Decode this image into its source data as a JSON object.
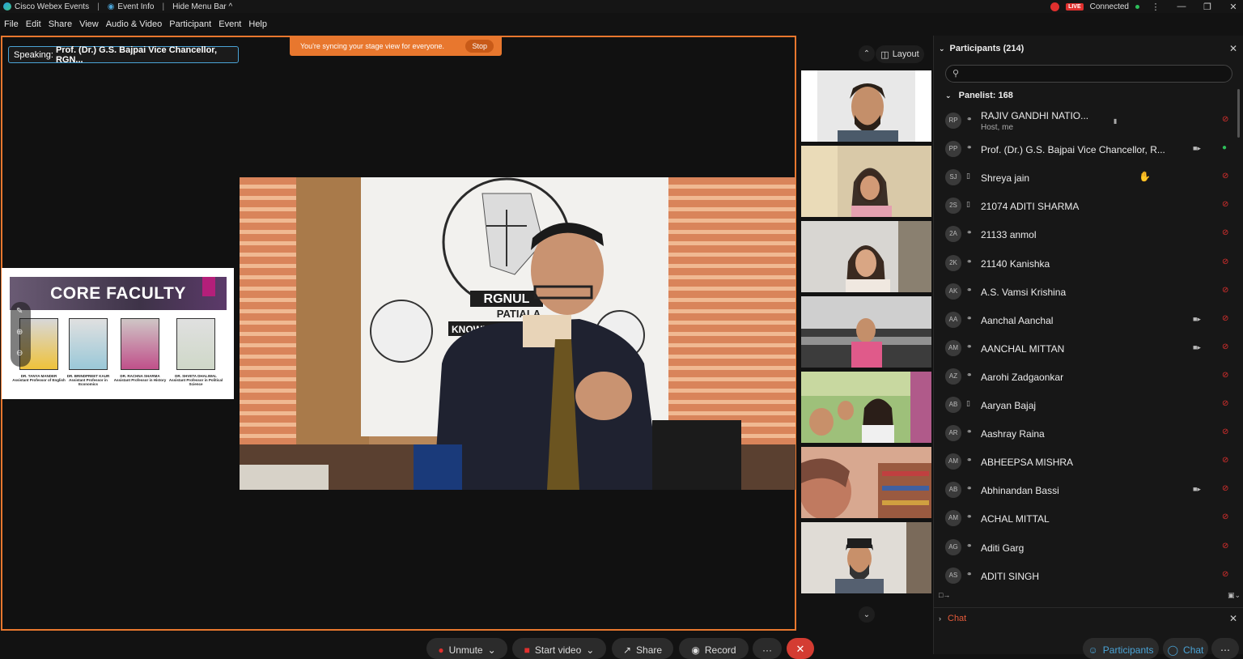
{
  "titlebar": {
    "app_name": "Cisco Webex Events",
    "event_info": "Event Info",
    "hide_menu_bar": "Hide Menu Bar",
    "live_badge": "LIVE",
    "connection_status": "Connected"
  },
  "menu": [
    "File",
    "Edit",
    "Share",
    "View",
    "Audio & Video",
    "Participant",
    "Event",
    "Help"
  ],
  "stage": {
    "speaking_label": "Speaking:",
    "speaking_name": "Prof. (Dr.) G.S. Bajpai Vice Chancellor, RGN...",
    "sync_message": "You're syncing your stage view for everyone.",
    "stop_label": "Stop"
  },
  "slide": {
    "title": "CORE FACULTY",
    "faculty": [
      {
        "name": "DR. TANYA MANDER",
        "role": "Assistant Professor of English"
      },
      {
        "name": "DR. BRINDPREET KAUR",
        "role": "Assistant Professor in Economics"
      },
      {
        "name": "DR. RACHNA SHARMA",
        "role": "Assistant Professor in History"
      },
      {
        "name": "DR. SHVETA DHALIWAL",
        "role": "Assistant Professor in Political Science"
      }
    ]
  },
  "video_backdrop": {
    "banner_text": "RGNUL",
    "city": "PATIALA",
    "tagline": "KNOWLEDGE EMPOWERS"
  },
  "layout_label": "Layout",
  "participants": {
    "header": "Participants (214)",
    "search_placeholder": "",
    "group_label": "Panelist: 168",
    "list": [
      {
        "initials": "RP",
        "name": "RAJIV GANDHI NATIO...",
        "subtitle": "Host, me",
        "device": "headset",
        "video": false,
        "mic": "muted"
      },
      {
        "initials": "PP",
        "name": "Prof. (Dr.) G.S. Bajpai Vice Chancellor, R...",
        "subtitle": "",
        "device": "headset",
        "video": true,
        "mic": "active"
      },
      {
        "initials": "SJ",
        "name": "Shreya jain",
        "subtitle": "",
        "device": "phone",
        "video": false,
        "mic": "muted",
        "hand": true
      },
      {
        "initials": "2S",
        "name": "21074 ADITI SHARMA",
        "subtitle": "",
        "device": "phone",
        "video": false,
        "mic": "muted"
      },
      {
        "initials": "2A",
        "name": "21133 anmol",
        "subtitle": "",
        "device": "headset",
        "video": false,
        "mic": "muted"
      },
      {
        "initials": "2K",
        "name": "21140 Kanishka",
        "subtitle": "",
        "device": "headset",
        "video": false,
        "mic": "muted"
      },
      {
        "initials": "AK",
        "name": "A.S. Vamsi Krishina",
        "subtitle": "",
        "device": "headset",
        "video": false,
        "mic": "muted"
      },
      {
        "initials": "AA",
        "name": "Aanchal Aanchal",
        "subtitle": "",
        "device": "headset",
        "video": true,
        "mic": "muted"
      },
      {
        "initials": "AM",
        "name": "AANCHAL MITTAN",
        "subtitle": "",
        "device": "headset",
        "video": true,
        "mic": "muted"
      },
      {
        "initials": "AZ",
        "name": "Aarohi Zadgaonkar",
        "subtitle": "",
        "device": "headset",
        "video": false,
        "mic": "muted"
      },
      {
        "initials": "AB",
        "name": "Aaryan Bajaj",
        "subtitle": "",
        "device": "phone",
        "video": false,
        "mic": "muted"
      },
      {
        "initials": "AR",
        "name": "Aashray Raina",
        "subtitle": "",
        "device": "headset",
        "video": false,
        "mic": "muted"
      },
      {
        "initials": "AM",
        "name": "ABHEEPSA MISHRA",
        "subtitle": "",
        "device": "headset",
        "video": false,
        "mic": "muted"
      },
      {
        "initials": "AB",
        "name": "Abhinandan Bassi",
        "subtitle": "",
        "device": "headset",
        "video": true,
        "mic": "muted"
      },
      {
        "initials": "AM",
        "name": "ACHAL MITTAL",
        "subtitle": "",
        "device": "headset",
        "video": false,
        "mic": "muted"
      },
      {
        "initials": "AG",
        "name": "Aditi Garg",
        "subtitle": "",
        "device": "headset",
        "video": false,
        "mic": "muted"
      },
      {
        "initials": "AS",
        "name": "ADITI SINGH",
        "subtitle": "",
        "device": "headset",
        "video": false,
        "mic": "muted"
      }
    ]
  },
  "chat": {
    "header": "Chat"
  },
  "controls": {
    "unmute": "Unmute",
    "start_video": "Start video",
    "share": "Share",
    "record": "Record",
    "more": "···",
    "participants": "Participants",
    "chat": "Chat"
  },
  "colors": {
    "accent_orange": "#e8772e",
    "live_red": "#e0302e",
    "connected_green": "#2dbf5a"
  }
}
